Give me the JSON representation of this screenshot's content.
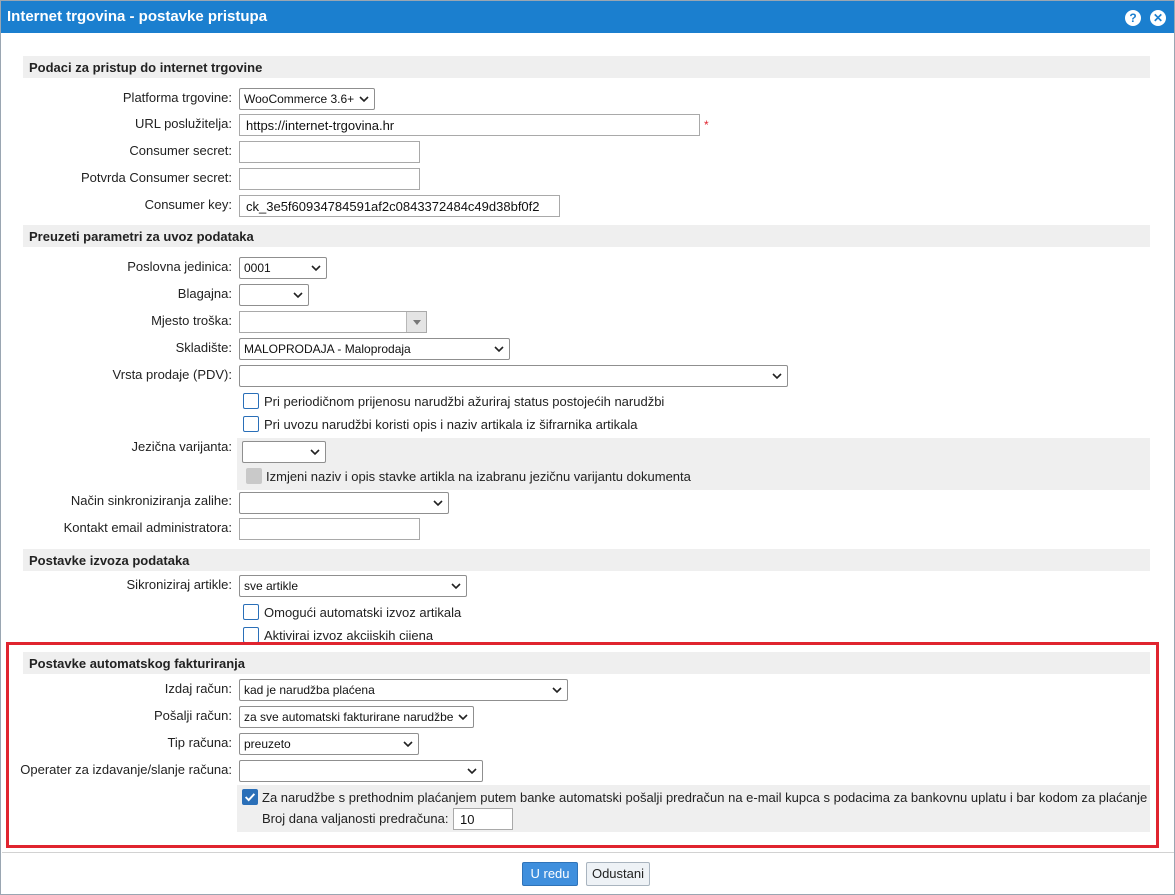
{
  "window": {
    "title": "Internet trgovina - postavke pristupa"
  },
  "access": {
    "heading": "Podaci za pristup do internet trgovine",
    "platform_label": "Platforma trgovine:",
    "platform_value": "WooCommerce 3.6+",
    "url_label": "URL poslužitelja:",
    "url_value": "https://internet-trgovina.hr",
    "required_mark": "*",
    "secret_label": "Consumer secret:",
    "secret_value": "",
    "secret_confirm_label": "Potvrda Consumer secret:",
    "secret_confirm_value": "",
    "key_label": "Consumer key:",
    "key_value": "ck_3e5f60934784591af2c0843372484c49d38bf0f2"
  },
  "import": {
    "heading": "Preuzeti parametri za uvoz podataka",
    "unit_label": "Poslovna jedinica:",
    "unit_value": "0001",
    "cashbox_label": "Blagajna:",
    "cashbox_value": "",
    "cost_label": "Mjesto troška:",
    "cost_value": "",
    "warehouse_label": "Skladište:",
    "warehouse_value": "MALOPRODAJA - Maloprodaja",
    "sale_type_label": "Vrsta prodaje (PDV):",
    "sale_type_value": "",
    "cb_update_status": "Pri periodičnom prijenosu narudžbi ažuriraj status postojećih narudžbi",
    "cb_use_catalog": "Pri uvozu narudžbi koristi opis i naziv artikala iz šifrarnika artikala",
    "language_label": "Jezična varijanta:",
    "language_value": "",
    "cb_change_name": "Izmjeni naziv i opis stavke artikla na izabranu jezičnu varijantu dokumenta",
    "sync_label": "Način sinkroniziranja zalihe:",
    "sync_value": "",
    "email_label": "Kontakt email administratora:",
    "email_value": ""
  },
  "export": {
    "heading": "Postavke izvoza podataka",
    "sync_articles_label": "Sikroniziraj artikle:",
    "sync_articles_value": "sve artikle",
    "cb_auto_export": "Omogući automatski izvoz artikala",
    "cb_promo_prices": "Aktiviraj izvoz akcijskih cijena"
  },
  "billing": {
    "heading": "Postavke automatskog fakturiranja",
    "issue_label": "Izdaj račun:",
    "issue_value": "kad je narudžba plaćena",
    "send_label": "Pošalji račun:",
    "send_value": "za sve automatski fakturirane narudžbe",
    "type_label": "Tip računa:",
    "type_value": "preuzeto",
    "operator_label": "Operater za izdavanje/slanje računa:",
    "operator_value": "",
    "cb_proforma": "Za narudžbe s prethodnim plaćanjem putem banke automatski pošalji predračun na e-mail kupca s podacima za bankovnu uplatu i bar kodom za plaćanje",
    "validity_label": "Broj dana valjanosti predračuna:",
    "validity_value": "10"
  },
  "footer": {
    "ok": "U redu",
    "cancel": "Odustani"
  },
  "colors": {
    "titlebar": "#1b7fcf",
    "highlight": "#e0242f",
    "primary_button": "#3f8fdd"
  }
}
